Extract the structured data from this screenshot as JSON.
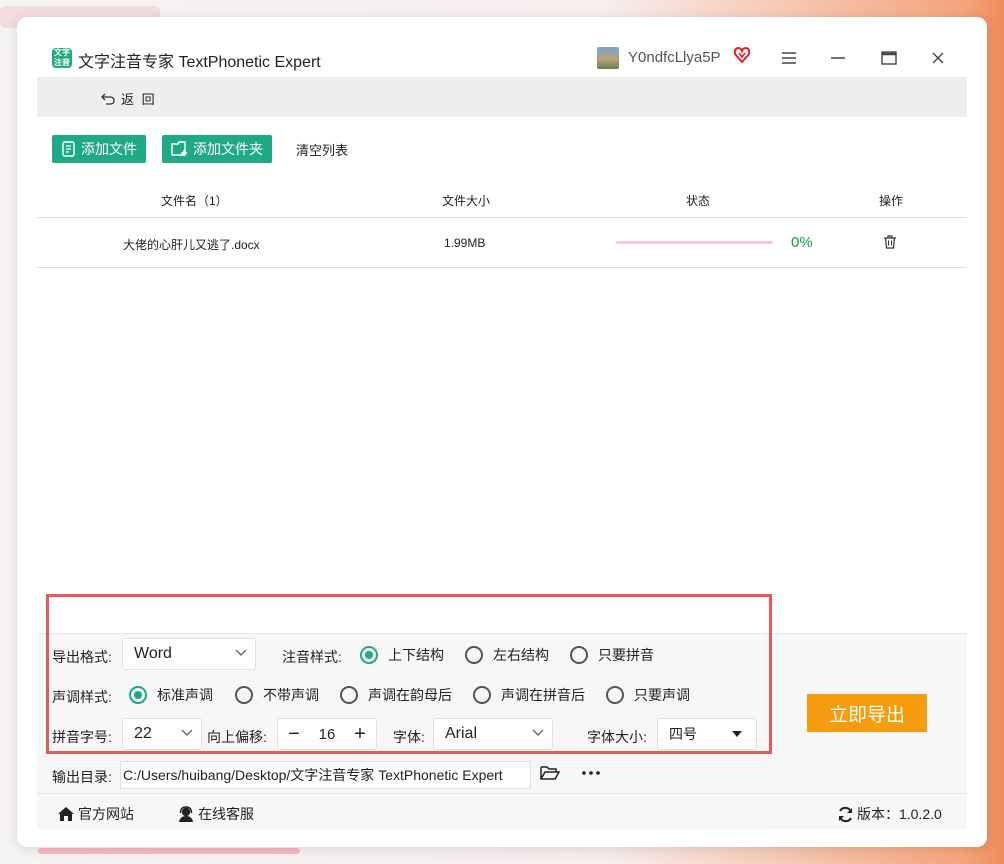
{
  "colors": {
    "accent": "#1fa987",
    "export": "#f59d0e",
    "progress_text": "#1aa33a",
    "highlight": "#e35a5a"
  },
  "app": {
    "logo_text": "文字\n注音",
    "title": "文字注音专家 TextPhonetic Expert"
  },
  "user": {
    "name": "Y0ndfcLlya5P",
    "vip_icon": "heart-badge-icon"
  },
  "window_controls": {
    "menu_icon": "hamburger-icon",
    "maximize_icon": "maximize-icon",
    "close_icon": "close-icon"
  },
  "nav": {
    "back_label": "返 回"
  },
  "toolbar": {
    "add_file": "添加文件",
    "add_folder": "添加文件夹",
    "clear_list": "清空列表"
  },
  "table": {
    "headers": {
      "name": "文件名（1）",
      "size": "文件大小",
      "status": "状态",
      "action": "操作"
    },
    "rows": [
      {
        "name": "大佬的心肝儿又逃了.docx",
        "size": "1.99MB",
        "progress": 0,
        "progress_text": "0%"
      }
    ]
  },
  "settings": {
    "export_format_label": "导出格式:",
    "export_format_value": "Word",
    "annotation_style_label": "注音样式:",
    "annotation_options": [
      "上下结构",
      "左右结构",
      "只要拼音"
    ],
    "annotation_selected": "上下结构",
    "tone_style_label": "声调样式:",
    "tone_options": [
      "标准声调",
      "不带声调",
      "声调在韵母后",
      "声调在拼音后",
      "只要声调"
    ],
    "tone_selected": "标准声调",
    "pinyin_size_label": "拼音字号:",
    "pinyin_size_value": "22",
    "offset_label": "向上偏移:",
    "offset_value": "16",
    "font_label": "字体:",
    "font_value": "Arial",
    "font_size_label": "字体大小:",
    "font_size_value": "四号",
    "output_dir_label": "输出目录:",
    "output_dir_value": "C:/Users/huibang/Desktop/文字注音专家 TextPhonetic Expert",
    "export_button": "立即导出"
  },
  "footer": {
    "website": "官方网站",
    "support": "在线客服",
    "version": "版本：1.0.2.0"
  }
}
